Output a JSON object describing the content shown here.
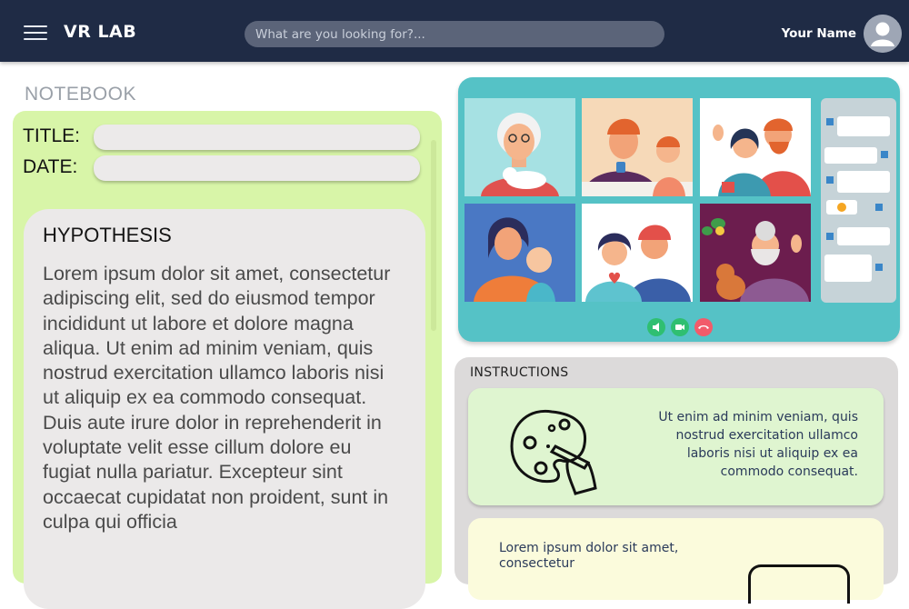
{
  "header": {
    "brand": "VR LAB",
    "search_placeholder": "What are you looking for?...",
    "user_name": "Your Name"
  },
  "notebook": {
    "section_label": "NOTEBOOK",
    "title_label": "TITLE:",
    "date_label": "DATE:",
    "title_value": "",
    "date_value": "",
    "hypothesis_heading": "HYPOTHESIS",
    "hypothesis_text": "Lorem ipsum dolor sit amet, consectetur adipiscing elit, sed do eiusmod tempor incididunt ut labore et dolore magna aliqua. Ut enim ad minim veniam, quis nostrud exercitation ullamco laboris nisi ut aliquip ex ea commodo consequat. Duis aute irure dolor in reprehenderit in voluptate velit esse cillum dolore eu fugiat nulla pariatur. Excepteur sint occaecat cupidatat non proident, sunt in culpa qui officia"
  },
  "video_call": {
    "participants": [
      "grandmother-with-cat",
      "father-and-daughter",
      "couple-waving",
      "mother-and-baby",
      "young-couple",
      "grandfather-with-dog"
    ],
    "controls": [
      "mic",
      "camera",
      "hang-up"
    ],
    "colors": {
      "panel": "#55c2c6",
      "mic": "#2fbf71",
      "camera": "#2fbf71",
      "hangup": "#f25b6a"
    }
  },
  "instructions": {
    "heading": "INSTRUCTIONS",
    "step1_text": "Ut enim ad minim veniam, quis nostrud exercitation ullamco laboris nisi ut aliquip ex ea commodo consequat.",
    "step1_icon": "palette-icon",
    "step2_text": "Lorem ipsum dolor sit amet, consectetur"
  }
}
